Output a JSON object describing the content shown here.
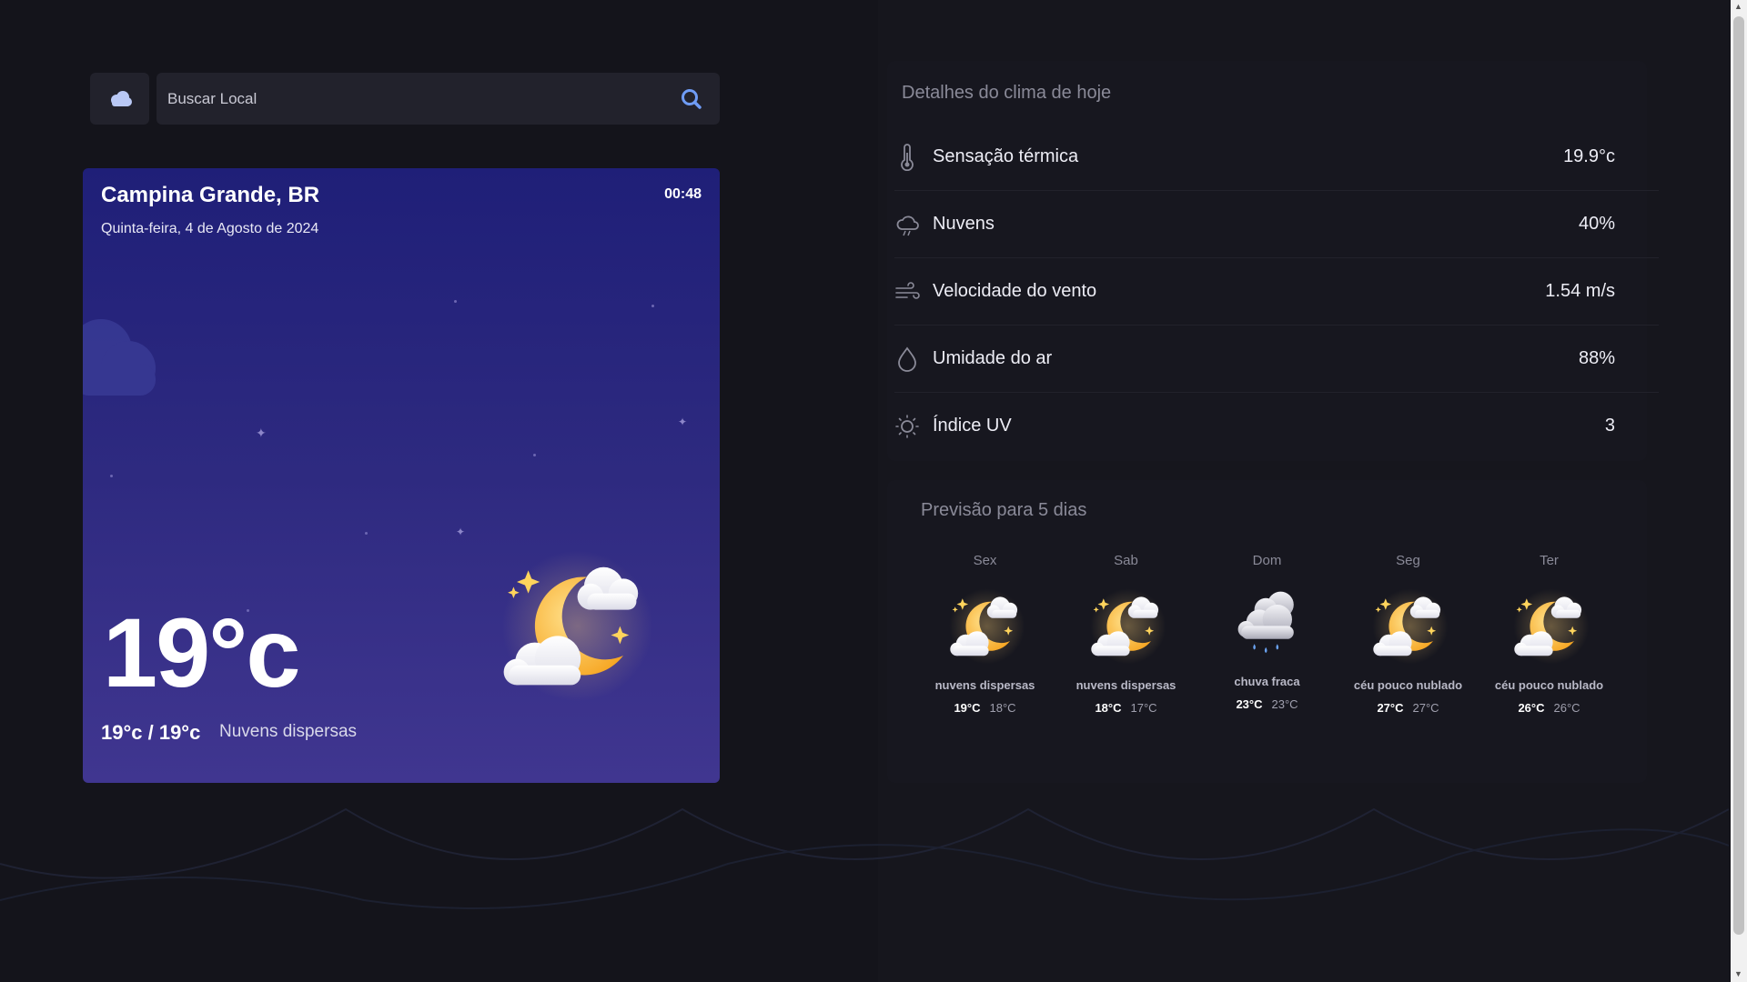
{
  "search": {
    "placeholder": "Buscar Local"
  },
  "current": {
    "city": "Campina Grande, BR",
    "time": "00:48",
    "date": "Quinta-feira, 4 de Agosto de 2024",
    "temperature": "19°c",
    "minmax": "19°c / 19°c",
    "description": "Nuvens dispersas",
    "icon": "night-cloud-moon-icon"
  },
  "details": {
    "title": "Detalhes do clima de hoje",
    "rows": [
      {
        "icon": "thermometer-icon",
        "label": "Sensação térmica",
        "value": "19.9°c"
      },
      {
        "icon": "cloud-icon",
        "label": "Nuvens",
        "value": "40%"
      },
      {
        "icon": "wind-icon",
        "label": "Velocidade do vento",
        "value": "1.54 m/s"
      },
      {
        "icon": "droplet-icon",
        "label": "Umidade do ar",
        "value": "88%"
      },
      {
        "icon": "sun-icon",
        "label": "Índice UV",
        "value": "3"
      }
    ]
  },
  "forecast": {
    "title": "Previsão para 5 dias",
    "days": [
      {
        "day": "Sex",
        "desc": "nuvens dispersas",
        "max": "19°C",
        "min": "18°C",
        "icon": "night-cloud-moon-icon"
      },
      {
        "day": "Sab",
        "desc": "nuvens dispersas",
        "max": "18°C",
        "min": "17°C",
        "icon": "night-cloud-moon-icon"
      },
      {
        "day": "Dom",
        "desc": "chuva fraca",
        "max": "23°C",
        "min": "23°C",
        "icon": "rain-cloud-icon"
      },
      {
        "day": "Seg",
        "desc": "céu pouco nublado",
        "max": "27°C",
        "min": "27°C",
        "icon": "night-cloud-moon-icon"
      },
      {
        "day": "Ter",
        "desc": "céu pouco nublado",
        "max": "26°C",
        "min": "26°C",
        "icon": "night-cloud-moon-icon"
      }
    ]
  },
  "colors": {
    "background": "#14141b",
    "panel": "#17171f",
    "card_top": "#1f1f78",
    "card_bottom": "#403690",
    "accent_blue": "#6f9cf5"
  }
}
